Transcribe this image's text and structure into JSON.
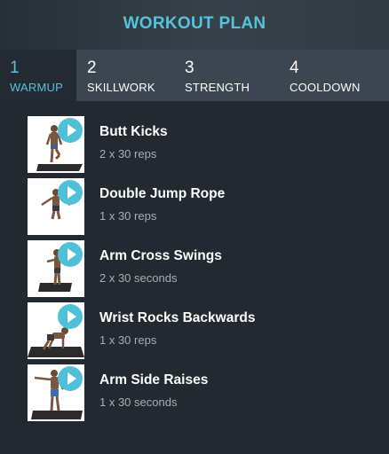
{
  "header": {
    "title": "WORKOUT PLAN"
  },
  "tabs": [
    {
      "number": "1",
      "label": "WARMUP"
    },
    {
      "number": "2",
      "label": "SKILLWORK"
    },
    {
      "number": "3",
      "label": "STRENGTH"
    },
    {
      "number": "4",
      "label": "COOLDOWN"
    }
  ],
  "exercises": [
    {
      "name": "Butt Kicks",
      "detail": "2 x 30 reps"
    },
    {
      "name": "Double Jump Rope",
      "detail": "1 x 30 reps"
    },
    {
      "name": "Arm Cross Swings",
      "detail": "2 x 30 seconds"
    },
    {
      "name": "Wrist Rocks Backwards",
      "detail": "1 x 30 reps"
    },
    {
      "name": "Arm Side Raises",
      "detail": "1 x 30 seconds"
    }
  ],
  "colors": {
    "accent": "#55c3da",
    "background": "#222930",
    "tab_bar": "#3b4650"
  }
}
